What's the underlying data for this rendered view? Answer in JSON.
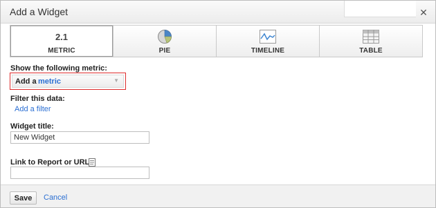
{
  "dialog": {
    "title": "Add a Widget",
    "close_icon": "close-icon",
    "close_glyph": "✕"
  },
  "widget_types": [
    {
      "label": "METRIC",
      "icon": "metric-icon",
      "icon_text": "2.1",
      "selected": true
    },
    {
      "label": "PIE",
      "icon": "pie-chart-icon",
      "selected": false
    },
    {
      "label": "TIMELINE",
      "icon": "timeline-chart-icon",
      "selected": false
    },
    {
      "label": "TABLE",
      "icon": "table-icon",
      "selected": false
    }
  ],
  "metric_section": {
    "label": "Show the following metric:",
    "prefix": "Add a",
    "metric_link": "metric",
    "dropdown_icon": "chevron-down-icon"
  },
  "filter_section": {
    "label": "Filter this data:",
    "add_filter_link": "Add a filter"
  },
  "title_section": {
    "label": "Widget title:",
    "value": "New Widget"
  },
  "link_section": {
    "label": "Link to Report or URL:",
    "icon": "document-icon",
    "value": ""
  },
  "footer": {
    "save_label": "Save",
    "cancel_label": "Cancel"
  },
  "colors": {
    "link": "#2b6fd3",
    "highlight_border": "#dd2b2b"
  }
}
